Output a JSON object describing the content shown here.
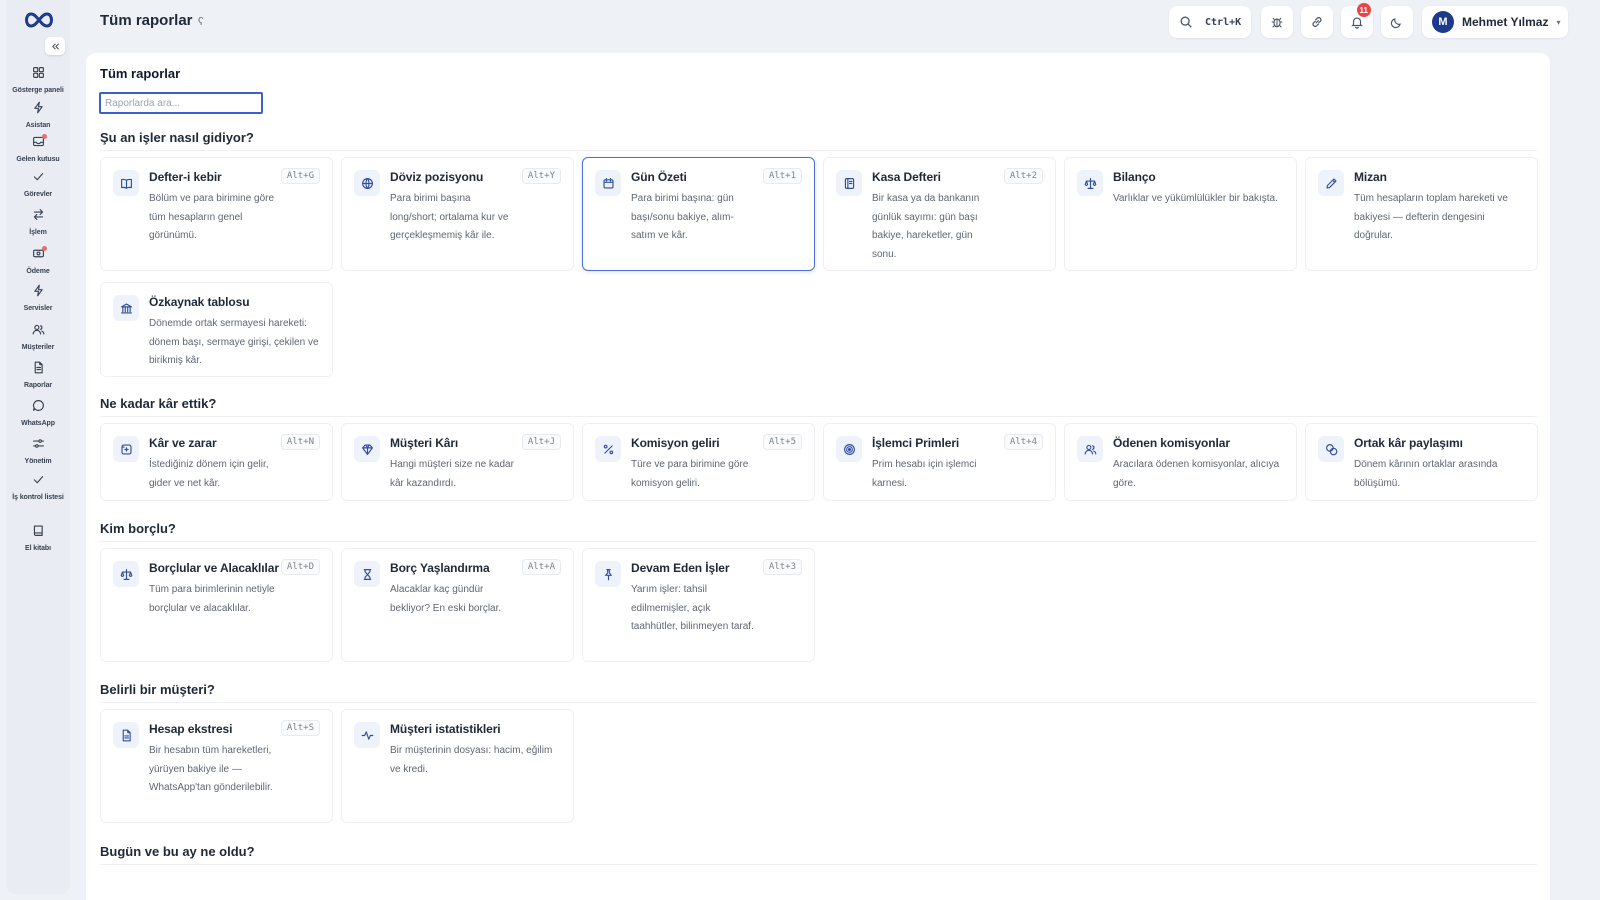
{
  "sidebar": {
    "items": [
      {
        "label": "Gösterge paneli",
        "icon": "dashboard-icon"
      },
      {
        "label": "Asistan",
        "icon": "bolt-icon"
      },
      {
        "label": "Gelen kutusu",
        "icon": "inbox-icon",
        "dot": true
      },
      {
        "label": "Görevler",
        "icon": "check-icon"
      },
      {
        "label": "İşlem",
        "icon": "swap-icon"
      },
      {
        "label": "Ödeme",
        "icon": "payment-icon",
        "dot": true
      },
      {
        "label": "Servisler",
        "icon": "bolt-icon"
      },
      {
        "label": "Müşteriler",
        "icon": "users-icon"
      },
      {
        "label": "Raporlar",
        "icon": "report-icon"
      },
      {
        "label": "WhatsApp",
        "icon": "chat-icon"
      },
      {
        "label": "Yönetim",
        "icon": "settings-sliders-icon"
      },
      {
        "label": "İş kontrol listesi",
        "icon": "checklist-icon"
      },
      {
        "label": "El kitabı",
        "icon": "book-icon"
      }
    ]
  },
  "header": {
    "title": "Tüm raporlar",
    "title_mark": "ʕ",
    "search_shortcut": "Ctrl+K",
    "notification_count": "11",
    "user_initial": "M",
    "user_name": "Mehmet Yılmaz",
    "caret": "▾"
  },
  "main": {
    "title": "Tüm raporlar",
    "search_placeholder": "Raporlarda ara...",
    "sections": [
      {
        "title": "Şu an işler nasıl gidiyor?",
        "cards": [
          {
            "title": "Defter-i kebir",
            "desc": "Bölüm ve para birimine göre tüm hesapların genel görünümü.",
            "kbd": "Alt+G",
            "icon": "book-open-icon"
          },
          {
            "title": "Döviz pozisyonu",
            "desc": "Para birimi başına long/short; ortalama kur ve gerçekleşmemiş kâr ile.",
            "kbd": "Alt+Y",
            "icon": "globe-icon"
          },
          {
            "title": "Gün Özeti",
            "desc": "Para birimi başına: gün başı/sonu bakiye, alım-satım ve kâr.",
            "kbd": "Alt+1",
            "icon": "calendar-icon",
            "active": true
          },
          {
            "title": "Kasa Defteri",
            "desc": "Bir kasa ya da bankanın günlük sayımı: gün başı bakiye, hareketler, gün sonu.",
            "kbd": "Alt+2",
            "icon": "ledger-icon"
          },
          {
            "title": "Bilanço",
            "desc": "Varlıklar ve yükümlülükler bir bakışta.",
            "kbd": "",
            "icon": "scale-icon"
          },
          {
            "title": "Mizan",
            "desc": "Tüm hesapların toplam hareketi ve bakiyesi — defterin dengesini doğrular.",
            "kbd": "",
            "icon": "pen-icon"
          },
          {
            "title": "Özkaynak tablosu",
            "desc": "Dönemde ortak sermayesi hareketi: dönem başı, sermaye girişi, çekilen ve birikmiş kâr.",
            "kbd": "",
            "icon": "bank-icon"
          }
        ]
      },
      {
        "title": "Ne kadar kâr ettik?",
        "cards": [
          {
            "title": "Kâr ve zarar",
            "desc": "İstediğiniz dönem için gelir, gider ve net kâr.",
            "kbd": "Alt+N",
            "icon": "receipt-icon"
          },
          {
            "title": "Müşteri Kârı",
            "desc": "Hangi müşteri size ne kadar kâr kazandırdı.",
            "kbd": "Alt+J",
            "icon": "diamond-icon"
          },
          {
            "title": "Komisyon geliri",
            "desc": "Türe ve para birimine göre komisyon geliri.",
            "kbd": "Alt+5",
            "icon": "percent-icon"
          },
          {
            "title": "İşlemci Primleri",
            "desc": "Prim hesabı için işlemci karnesi.",
            "kbd": "Alt+4",
            "icon": "target-icon"
          },
          {
            "title": "Ödenen komisyonlar",
            "desc": "Aracılara ödenen komisyonlar, alıcıya göre.",
            "kbd": "",
            "icon": "users-icon"
          },
          {
            "title": "Ortak kâr paylaşımı",
            "desc": "Dönem kârının ortaklar arasında bölüşümü.",
            "kbd": "",
            "icon": "coins-icon"
          }
        ]
      },
      {
        "title": "Kim borçlu?",
        "cards": [
          {
            "title": "Borçlular ve Alacaklılar",
            "desc": "Tüm para birimlerinin netiyle borçlular ve alacaklılar.",
            "kbd": "Alt+D",
            "icon": "scale-icon"
          },
          {
            "title": "Borç Yaşlandırma",
            "desc": "Alacaklar kaç gündür bekliyor? En eski borçlar.",
            "kbd": "Alt+A",
            "icon": "hourglass-icon"
          },
          {
            "title": "Devam Eden İşler",
            "desc": "Yarım işler: tahsil edilmemişler, açık taahhütler, bilinmeyen taraf.",
            "kbd": "Alt+3",
            "icon": "pin-icon"
          }
        ]
      },
      {
        "title": "Belirli bir müşteri?",
        "cards": [
          {
            "title": "Hesap ekstresi",
            "desc": "Bir hesabın tüm hareketleri, yürüyen bakiye ile — WhatsApp'tan gönderilebilir.",
            "kbd": "Alt+S",
            "icon": "file-icon"
          },
          {
            "title": "Müşteri istatistikleri",
            "desc": "Bir müşterinin dosyası: hacim, eğilim ve kredi.",
            "kbd": "",
            "icon": "activity-icon"
          }
        ]
      },
      {
        "title": "Bugün ve bu ay ne oldu?",
        "cards": []
      }
    ]
  },
  "colors": {
    "accent": "#3b62c9",
    "icon": "#2f4f9e",
    "badge": "#ef4444"
  }
}
